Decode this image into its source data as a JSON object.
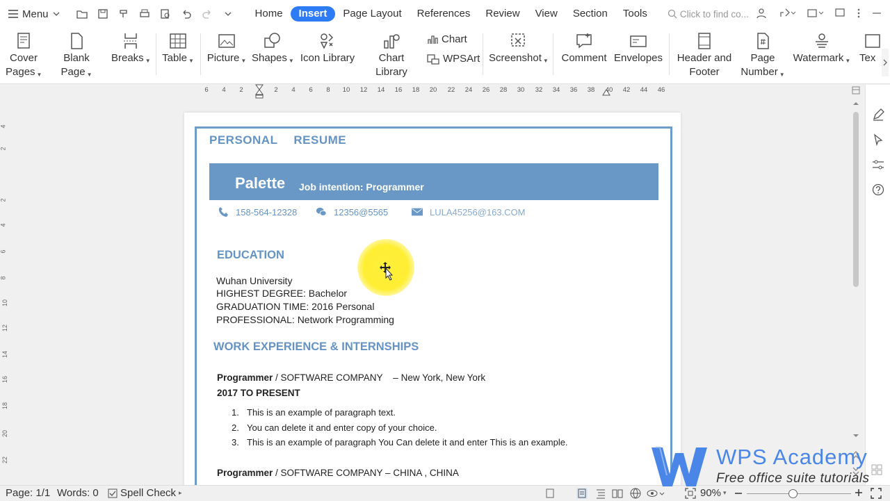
{
  "topbar": {
    "menu_label": "Menu",
    "tabs": [
      {
        "label": "Home"
      },
      {
        "label": "Insert",
        "active": true
      },
      {
        "label": "Page Layout"
      },
      {
        "label": "References"
      },
      {
        "label": "Review"
      },
      {
        "label": "View"
      },
      {
        "label": "Section"
      },
      {
        "label": "Tools"
      }
    ],
    "find_placeholder": "Click to find co..."
  },
  "ribbon": {
    "cover_pages": "Cover\nPages",
    "blank_page": "Blank Page",
    "breaks": "Breaks",
    "table": "Table",
    "picture": "Picture",
    "shapes": "Shapes",
    "icon_library": "Icon Library",
    "chart_library": "Chart Library",
    "chart": "Chart",
    "wpsart": "WPSArt",
    "screenshot": "Screenshot",
    "comment": "Comment",
    "envelopes": "Envelopes",
    "header_footer": "Header and\nFooter",
    "page_number": "Page\nNumber",
    "watermark": "Watermark",
    "text_partial": "Tex"
  },
  "ruler": {
    "h_ticks": [
      "6",
      "4",
      "2",
      "2",
      "4",
      "6",
      "8",
      "10",
      "12",
      "14",
      "16",
      "18",
      "20",
      "22",
      "24",
      "26",
      "28",
      "30",
      "32",
      "34",
      "36",
      "38",
      "40",
      "42",
      "44",
      "46"
    ],
    "v_ticks": [
      "4",
      "2",
      "2",
      "4",
      "6",
      "8",
      "10",
      "12",
      "14",
      "16",
      "18",
      "20",
      "22"
    ]
  },
  "document": {
    "resume_title": "PERSONAL   RESUME",
    "name": "Palette",
    "job_intention": "Job intention:  Programmer",
    "phone": "158-564-12328",
    "wechat": "12356@5565",
    "email": "LULA45256@163.COM",
    "education_heading": "EDUCATION",
    "education_lines": [
      "Wuhan University",
      "HIGHEST DEGREE: Bachelor",
      "GRADUATION TIME: 2016 Personal",
      "PROFESSIONAL: Network Programming"
    ],
    "work_heading": "WORK EXPERIENCE & INTERNSHIPS",
    "job1_title": "Programmer",
    "job1_company": " / SOFTWARE COMPANY    – New York, New York",
    "job1_period": "2017 TO PRESENT",
    "job1_bullets": [
      "This is an example of paragraph text.",
      "You can delete it and enter copy of your choice.",
      "This is an example of paragraph You Can delete it and enter This is an example."
    ],
    "job2_title": "Programmer",
    "job2_company": " / SOFTWARE COMPANY – CHINA , CHINA"
  },
  "status": {
    "page": "Page: 1/1",
    "words": "Words: 0",
    "spell_check": "Spell Check",
    "zoom": "90%"
  },
  "watermark_brand": {
    "line1": "WPS Academy",
    "line2": "Free office suite tutorials"
  },
  "colors": {
    "accent": "#2d7cf6",
    "resume_blue": "#6a98c6"
  }
}
